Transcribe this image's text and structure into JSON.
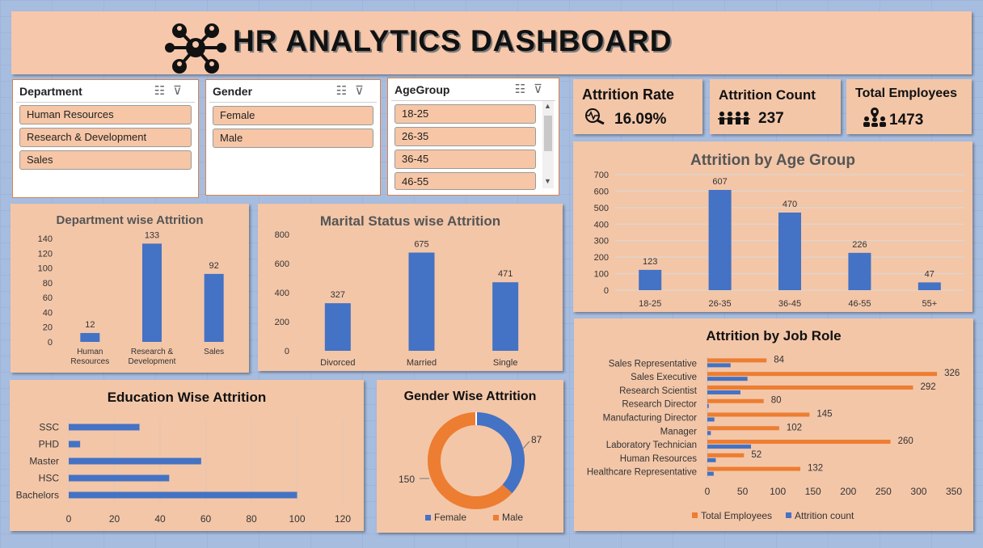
{
  "title": "HR ANALYTICS DASHBOARD",
  "colors": {
    "accent": "#4472c4",
    "orange": "#ed7d31",
    "panel": "#f3c6a8"
  },
  "slicers": [
    {
      "header": "Department",
      "items": [
        "Human Resources",
        "Research & Development",
        "Sales"
      ]
    },
    {
      "header": "Gender",
      "items": [
        "Female",
        "Male"
      ]
    },
    {
      "header": "AgeGroup",
      "items": [
        "18-25",
        "26-35",
        "36-45",
        "46-55"
      ]
    }
  ],
  "kpis": {
    "attrition_rate": {
      "label": "Attrition Rate",
      "value": "16.09%",
      "icon": "heartbeat-search-icon"
    },
    "attrition_count": {
      "label": "Attrition Count",
      "value": "237",
      "icon": "people-group-icon"
    },
    "total_employees": {
      "label": "Total Employees",
      "value": "1473",
      "icon": "team-location-icon"
    }
  },
  "chart_data": [
    {
      "type": "bar",
      "title": "Department wise Attrition",
      "categories": [
        "Human Resources",
        "Research & Development",
        "Sales"
      ],
      "values": [
        12,
        133,
        92
      ],
      "ylim": [
        0,
        140
      ],
      "yticks": [
        "0",
        "20",
        "40",
        "60",
        "80",
        "100",
        "120",
        "140"
      ]
    },
    {
      "type": "bar",
      "title": "Marital Status wise Attrition",
      "categories": [
        "Divorced",
        "Married",
        "Single"
      ],
      "values": [
        327,
        675,
        471
      ],
      "ylim": [
        0,
        800
      ],
      "yticks": [
        "0",
        "200",
        "400",
        "600",
        "800"
      ]
    },
    {
      "type": "bar",
      "title": "Attrition by Age Group",
      "categories": [
        "18-25",
        "26-35",
        "36-45",
        "46-55",
        "55+"
      ],
      "values": [
        123,
        607,
        470,
        226,
        47
      ],
      "ylim": [
        0,
        700
      ],
      "yticks": [
        "0",
        "100",
        "200",
        "300",
        "400",
        "500",
        "600",
        "700"
      ]
    },
    {
      "type": "bar",
      "orientation": "horizontal",
      "title": "Education Wise Attrition",
      "categories": [
        "SSC",
        "PHD",
        "Master",
        "HSC",
        "Bachelors"
      ],
      "values": [
        31,
        5,
        58,
        44,
        100
      ],
      "xlim": [
        0,
        120
      ],
      "xticks": [
        "0",
        "20",
        "40",
        "60",
        "80",
        "100",
        "120"
      ]
    },
    {
      "type": "pie",
      "title": "Gender Wise Attrition",
      "categories": [
        "Female",
        "Male"
      ],
      "values": [
        87,
        150
      ],
      "labels": [
        "87",
        "150"
      ]
    },
    {
      "type": "bar",
      "orientation": "horizontal",
      "title": "Attrition by Job Role",
      "categories": [
        "Sales Representative",
        "Sales Executive",
        "Research Scientist",
        "Research Director",
        "Manufacturing Director",
        "Manager",
        "Laboratory Technician",
        "Human Resources",
        "Healthcare Representative"
      ],
      "series": [
        {
          "name": "Total Employees",
          "values": [
            84,
            326,
            292,
            80,
            145,
            102,
            260,
            52,
            132
          ]
        },
        {
          "name": "Attrition count",
          "values": [
            33,
            57,
            47,
            2,
            10,
            5,
            62,
            12,
            9
          ]
        }
      ],
      "xlim": [
        0,
        350
      ],
      "xticks": [
        "0",
        "50",
        "100",
        "150",
        "200",
        "250",
        "300",
        "350"
      ]
    }
  ]
}
